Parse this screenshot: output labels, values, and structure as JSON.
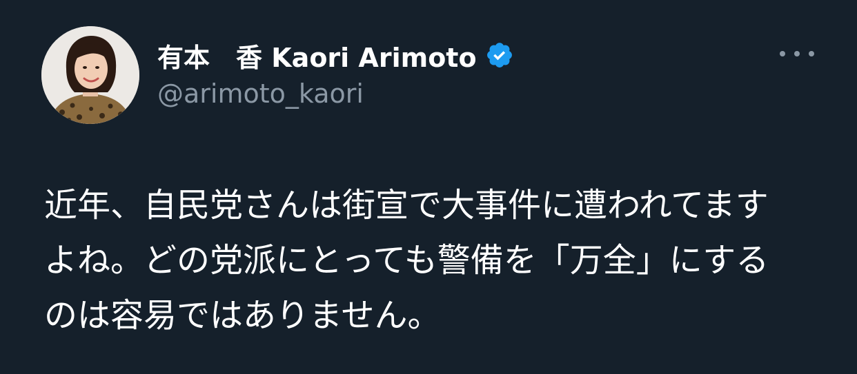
{
  "author": {
    "display_name": "有本　香  Kaori Arimoto",
    "handle": "@arimoto_kaori",
    "verified_icon": "verified-badge-icon",
    "avatar_icon": "avatar-photo"
  },
  "menu": {
    "icon": "more-horizontal-icon"
  },
  "tweet": {
    "lines": [
      "近年、自民党さんは街宣で大事件に遭われてます",
      "よね。どの党派にとっても警備を「万全」にする",
      "のは容易ではありません。"
    ]
  },
  "colors": {
    "background": "#15202b",
    "text": "#ffffff",
    "secondary_text": "#8b98a5",
    "verified_blue": "#1d9bf0"
  }
}
